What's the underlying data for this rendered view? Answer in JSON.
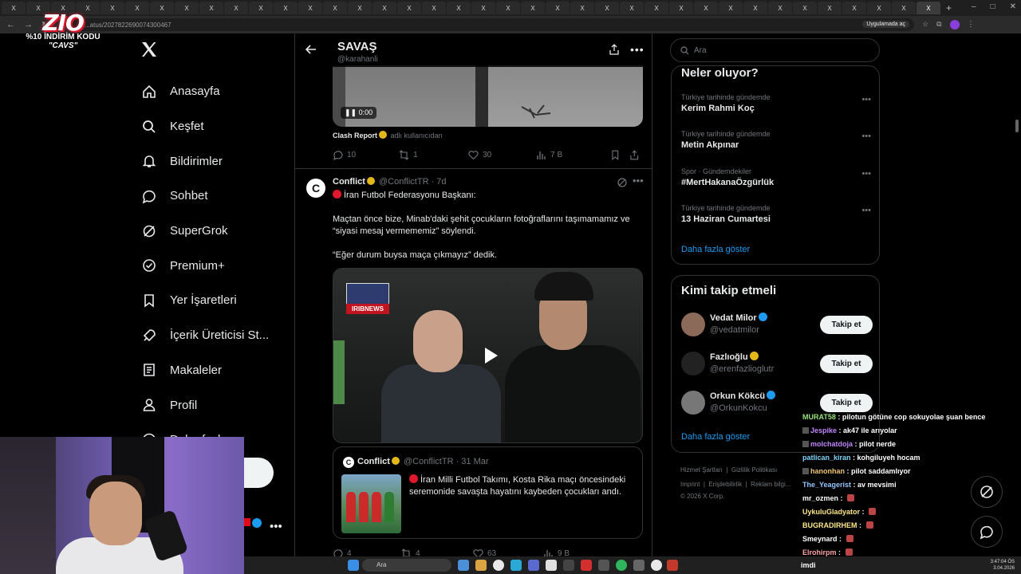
{
  "browser": {
    "tab_label": "X",
    "url": "...atus/2027822690074300467",
    "app_chip": "Uygulamada aç"
  },
  "promo": {
    "logo": "ZIO",
    "line1": "%10 İNDİRİM KODU",
    "line2": "\"CAVS\""
  },
  "sidebar": {
    "items": [
      {
        "label": "Anasayfa",
        "icon": "home-icon"
      },
      {
        "label": "Keşfet",
        "icon": "search-icon"
      },
      {
        "label": "Bildirimler",
        "icon": "bell-icon"
      },
      {
        "label": "Sohbet",
        "icon": "chat-icon"
      },
      {
        "label": "SuperGrok",
        "icon": "grok-icon"
      },
      {
        "label": "Premium+",
        "icon": "verified-icon"
      },
      {
        "label": "Yer İşaretleri",
        "icon": "bookmark-icon"
      },
      {
        "label": "İçerik Üreticisi St...",
        "icon": "rocket-icon"
      },
      {
        "label": "Makaleler",
        "icon": "article-icon"
      },
      {
        "label": "Profil",
        "icon": "person-icon"
      },
      {
        "label": "Daha fazla",
        "icon": "more-circle-icon"
      }
    ]
  },
  "main": {
    "header_title": "SAVAŞ",
    "header_handle": "@karahanli",
    "prev_video_time": "0:00",
    "attribution_name": "Clash Report",
    "attribution_suffix": "adlı kullanıcıdan",
    "prev_actions": {
      "replies": "10",
      "reposts": "1",
      "likes": "30",
      "views": "7 B"
    },
    "tweet": {
      "name": "Conflict",
      "handle_time": "@ConflictTR · 7d",
      "line1": "İran Futbol Federasyonu Başkanı:",
      "para1": "Maçtan önce bize, Minab'daki şehit çocukların fotoğraflarını taşımamamız ve “siyasi mesaj vermememiz” söylendi.",
      "para2": "“Eğer durum buysa maça çıkmayız” dedik.",
      "video_logo": "IRIBNEWS"
    },
    "quote": {
      "name": "Conflict",
      "handle_time": "@ConflictTR · 31 Mar",
      "text": "İran Milli Futbol Takımı, Kosta Rika maçı öncesindeki seremonide savaşta hayatını kaybeden çocukları andı."
    },
    "bottom_actions": {
      "replies": "4",
      "reposts": "4",
      "likes": "63",
      "views": "9 B"
    }
  },
  "right": {
    "search_placeholder": "Ara",
    "trends_title": "Neler oluyor?",
    "trends": [
      {
        "context": "Türkiye tarihinde gündemde",
        "topic": "Kerim Rahmi Koç"
      },
      {
        "context": "Türkiye tarihinde gündemde",
        "topic": "Metin Akpınar"
      },
      {
        "context": "Spor · Gündemdekiler",
        "topic": "#MertHakanaÖzgürlük"
      },
      {
        "context": "Türkiye tarihinde gündemde",
        "topic": "13 Haziran Cumartesi"
      }
    ],
    "show_more": "Daha fazla göster",
    "who_title": "Kimi takip etmeli",
    "who": [
      {
        "name": "Vedat Milor",
        "handle": "@vedatmilor",
        "badge": "#1d9bf0"
      },
      {
        "name": "Fazlıoğlu",
        "handle": "@erenfazlioglutr",
        "badge": "#e2b719"
      },
      {
        "name": "Orkun Kökcü",
        "handle": "@OrkunKokcu",
        "badge": "#1d9bf0"
      }
    ],
    "follow_label": "Takip et",
    "footer_line1": [
      "Hizmet Şartları",
      "Gizlilik Politikası"
    ],
    "footer_line2": [
      "Imprint",
      "Erişilebilirlik",
      "Reklam bilgi..."
    ],
    "footer_line3": "© 2026 X Corp."
  },
  "chat": [
    {
      "user": "MURAT58",
      "color": "#9be37b",
      "text": "pilotun götüne cop sokuyolae şuan bence",
      "badge": false,
      "emote": false
    },
    {
      "user": "Jespike",
      "color": "#c084fc",
      "text": "ak47 ile arıyolar",
      "badge": true,
      "emote": false
    },
    {
      "user": "molchatdoja",
      "color": "#c084fc",
      "text": "pilot nerde",
      "badge": true,
      "emote": false
    },
    {
      "user": "patlican_kiran",
      "color": "#7dd3fc",
      "text": "kohgiluyeh hocam",
      "badge": false,
      "emote": false
    },
    {
      "user": "hanonhan",
      "color": "#f0c674",
      "text": "pilot saddamlıyor",
      "badge": true,
      "emote": false
    },
    {
      "user": "The_Yeagerist",
      "color": "#93c5fd",
      "text": "av mevsimi",
      "badge": false,
      "emote": false
    },
    {
      "user": "mr_ozmen",
      "color": "#ffffff",
      "text": "",
      "badge": false,
      "emote": true
    },
    {
      "user": "UykuluGladyator",
      "color": "#fde68a",
      "text": "",
      "badge": false,
      "emote": true
    },
    {
      "user": "BUGRADIRHEM",
      "color": "#fde68a",
      "text": "",
      "badge": false,
      "emote": true
    },
    {
      "user": "Smeynard",
      "color": "#ffffff",
      "text": "",
      "badge": false,
      "emote": true
    },
    {
      "user": "Elrohirpm",
      "color": "#fca5a5",
      "text": "",
      "badge": false,
      "emote": true
    }
  ],
  "taskbar": {
    "search": "Ara",
    "label": "imdi",
    "time": "3:47:04 ÖS",
    "date": "3.04.2026"
  }
}
